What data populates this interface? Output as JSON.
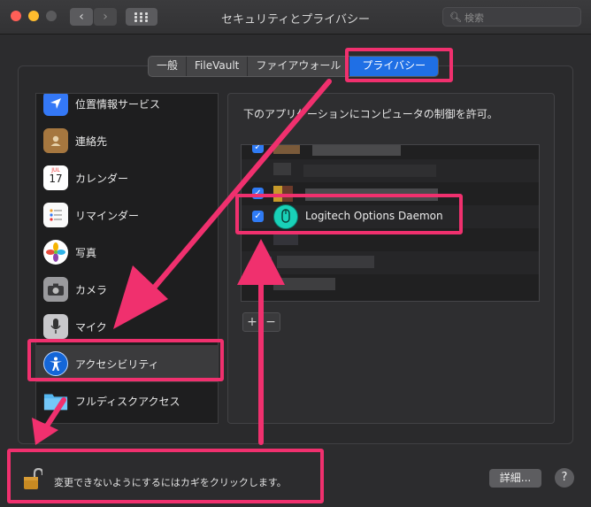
{
  "window": {
    "title": "セキュリティとプライバシー"
  },
  "search": {
    "placeholder": "検索"
  },
  "tabs": [
    {
      "label": "一般"
    },
    {
      "label": "FileVault"
    },
    {
      "label": "ファイアウォール"
    },
    {
      "label": "プライバシー",
      "active": true
    }
  ],
  "sidebar": {
    "items": [
      {
        "label": "位置情報サービス",
        "icon": "location-arrow-icon"
      },
      {
        "label": "連絡先",
        "icon": "contacts-book-icon"
      },
      {
        "label": "カレンダー",
        "icon": "calendar-icon",
        "icon_month": "JUL",
        "icon_day": "17"
      },
      {
        "label": "リマインダー",
        "icon": "reminders-icon"
      },
      {
        "label": "写真",
        "icon": "photos-icon"
      },
      {
        "label": "カメラ",
        "icon": "camera-icon"
      },
      {
        "label": "マイク",
        "icon": "microphone-icon"
      },
      {
        "label": "アクセシビリティ",
        "icon": "accessibility-icon",
        "selected": true
      },
      {
        "label": "フルディスクアクセス",
        "icon": "folder-icon"
      }
    ]
  },
  "main": {
    "heading": "下のアプリケーションにコンピュータの制御を許可。",
    "apps": [
      {
        "name": "",
        "checked": true,
        "blurred": true
      },
      {
        "name": "",
        "checked": true,
        "blurred": true
      },
      {
        "name": "Logitech Options Daemon",
        "checked": true,
        "blurred": false
      },
      {
        "name": "",
        "checked": false,
        "blurred": true
      },
      {
        "name": "",
        "checked": false,
        "blurred": true
      }
    ],
    "add_label": "+",
    "remove_label": "−"
  },
  "footer": {
    "lock_text": "変更できないようにするにはカギをクリックします。",
    "details_label": "詳細...",
    "help_label": "?"
  },
  "colors": {
    "highlight": "#f0306e",
    "accent": "#1f6fe5",
    "checkbox": "#2f7bf5"
  }
}
